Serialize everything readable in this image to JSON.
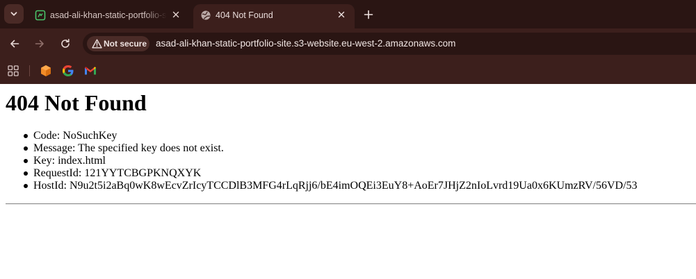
{
  "browser": {
    "tabs": [
      {
        "title": "asad-ali-khan-static-portfolio-site",
        "favicon": "site-favicon",
        "active": false
      },
      {
        "title": "404 Not Found",
        "favicon": "globe-icon",
        "active": true
      }
    ],
    "address_bar": {
      "security_label": "Not secure",
      "url": "asad-ali-khan-static-portfolio-site.s3-website.eu-west-2.amazonaws.com"
    },
    "bookmarks": [
      {
        "icon": "apps-grid-icon"
      },
      {
        "icon": "cube-extension-icon"
      },
      {
        "icon": "google-icon"
      },
      {
        "icon": "gmail-icon"
      }
    ],
    "colors": {
      "chrome_bg": "#3c1f1c",
      "tabstrip_bg": "#2a1513",
      "omnibox_bg": "#2a1513"
    }
  },
  "page": {
    "heading": "404 Not Found",
    "details": [
      "Code: NoSuchKey",
      "Message: The specified key does not exist.",
      "Key: index.html",
      "RequestId: 121YYTCBGPKNQXYK",
      "HostId: N9u2t5i2aBq0wK8wEcvZrIcyTCCDlB3MFG4rLqRjj6/bE4imOQEi3EuY8+AoEr7JHjZ2nIoLvrd19Ua0x6KUmzRV/56VD/53"
    ]
  }
}
